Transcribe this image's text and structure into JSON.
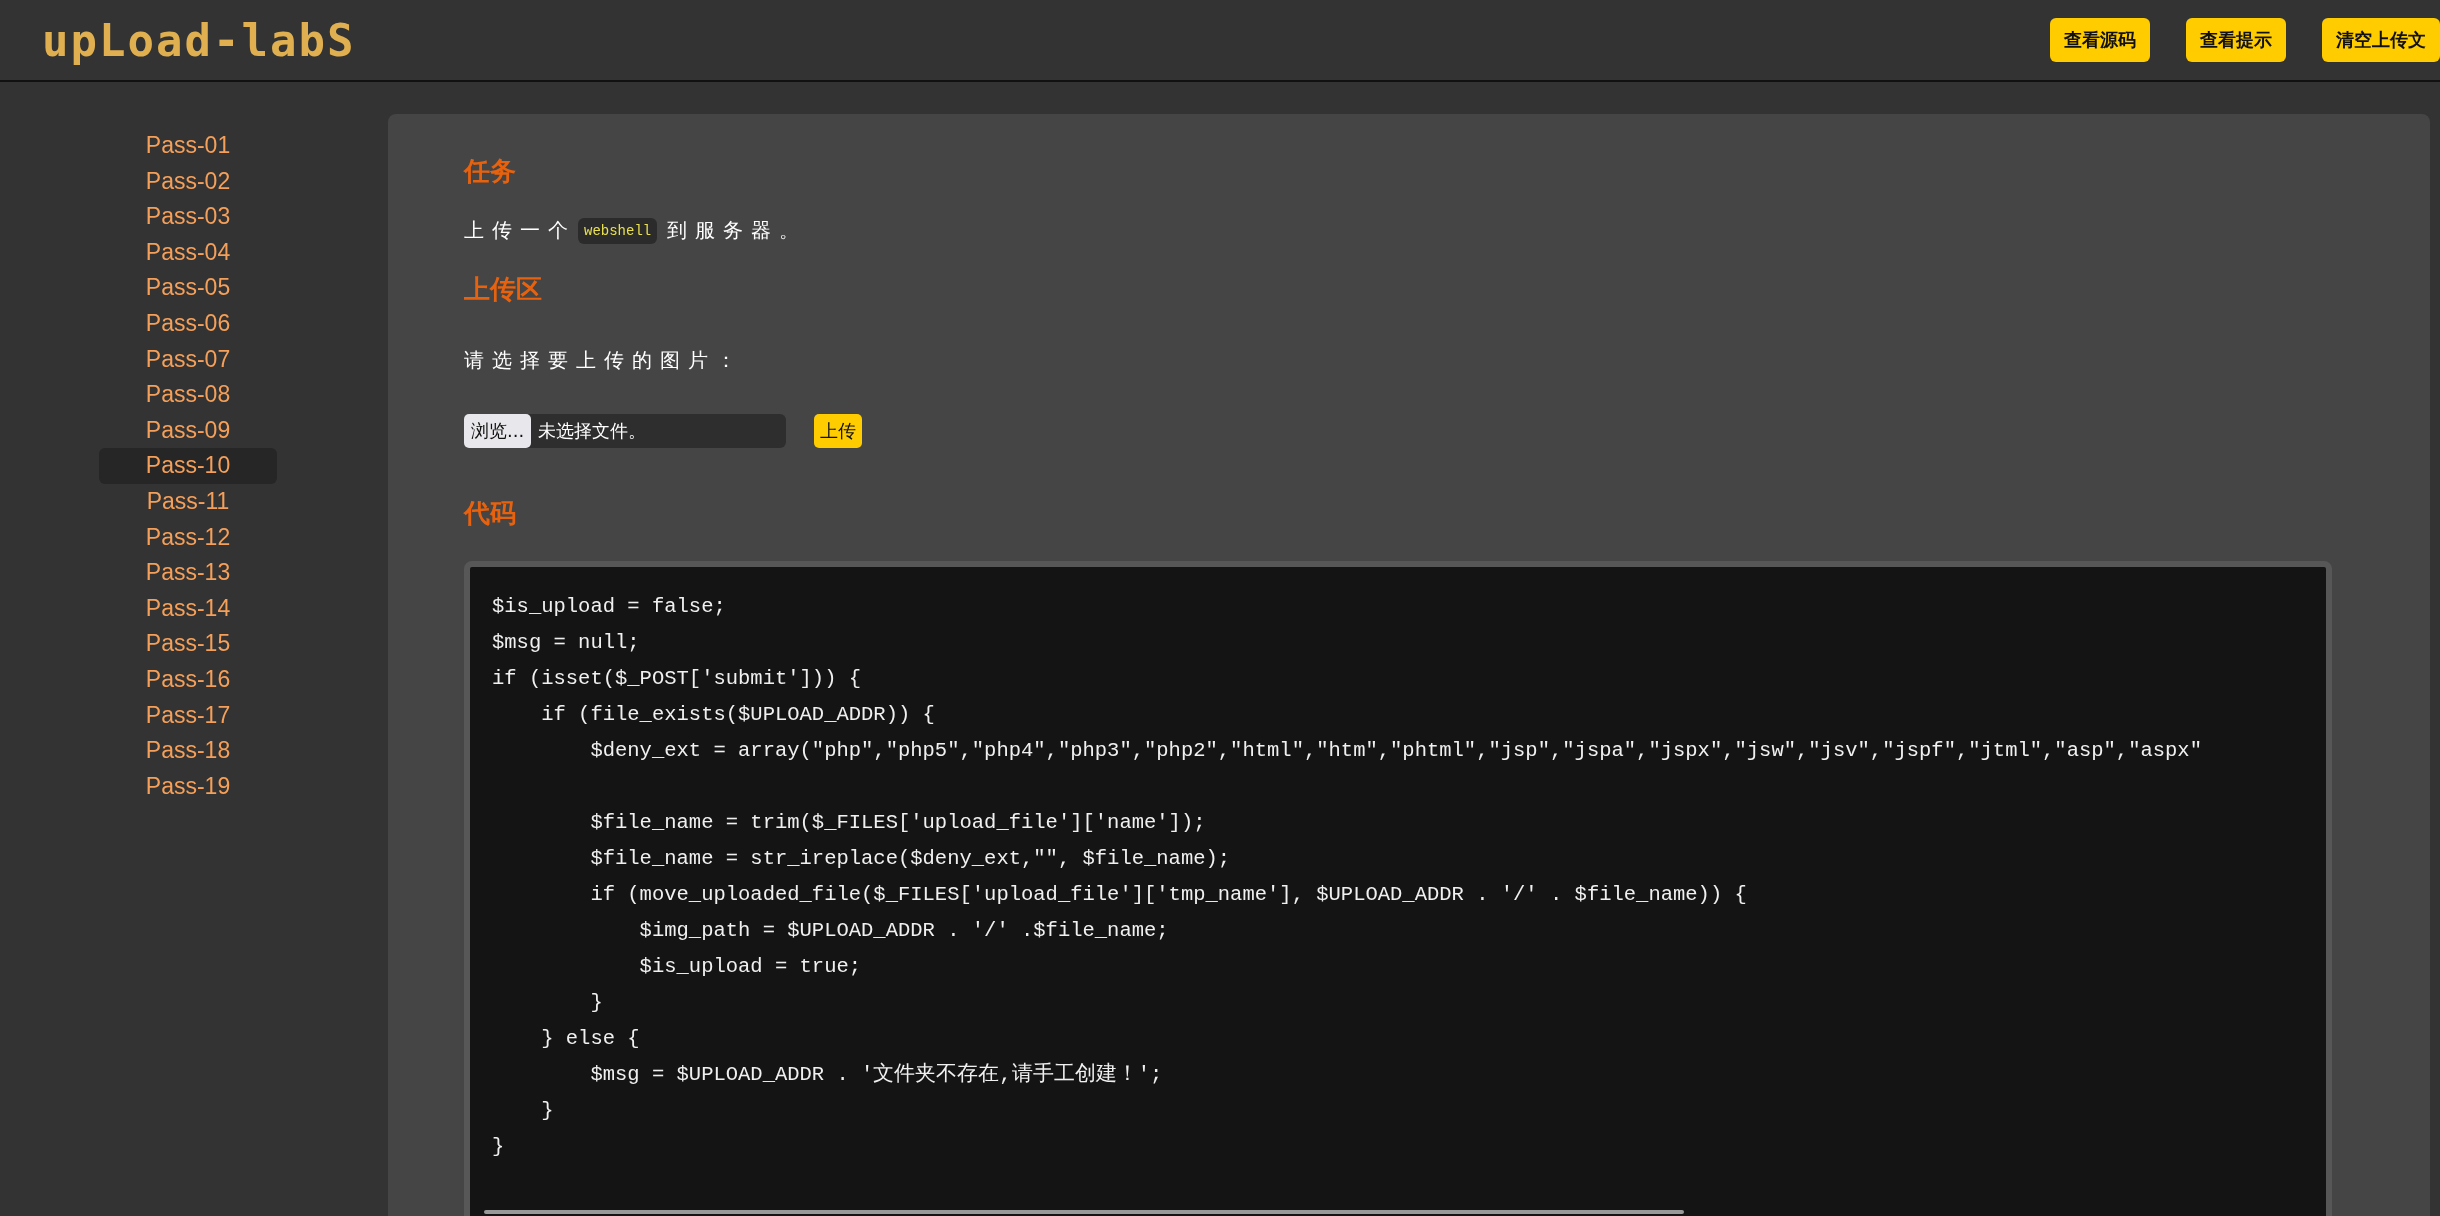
{
  "header": {
    "logo": "upLoad-labS",
    "buttons": [
      "查看源码",
      "查看提示",
      "清空上传文"
    ]
  },
  "sidebar": {
    "items": [
      {
        "label": "Pass-01",
        "selected": false
      },
      {
        "label": "Pass-02",
        "selected": false
      },
      {
        "label": "Pass-03",
        "selected": false
      },
      {
        "label": "Pass-04",
        "selected": false
      },
      {
        "label": "Pass-05",
        "selected": false
      },
      {
        "label": "Pass-06",
        "selected": false
      },
      {
        "label": "Pass-07",
        "selected": false
      },
      {
        "label": "Pass-08",
        "selected": false
      },
      {
        "label": "Pass-09",
        "selected": false
      },
      {
        "label": "Pass-10",
        "selected": true
      },
      {
        "label": "Pass-11",
        "selected": false
      },
      {
        "label": "Pass-12",
        "selected": false
      },
      {
        "label": "Pass-13",
        "selected": false
      },
      {
        "label": "Pass-14",
        "selected": false
      },
      {
        "label": "Pass-15",
        "selected": false
      },
      {
        "label": "Pass-16",
        "selected": false
      },
      {
        "label": "Pass-17",
        "selected": false
      },
      {
        "label": "Pass-18",
        "selected": false
      },
      {
        "label": "Pass-19",
        "selected": false
      }
    ]
  },
  "task": {
    "heading": "任务",
    "text_before": "上传一个",
    "code": "webshell",
    "text_after": "到服务器。"
  },
  "upload": {
    "heading": "上传区",
    "prompt": "请选择要上传的图片：",
    "browse_button": "浏览...",
    "file_status": "未选择文件。",
    "submit_button": "上传"
  },
  "code_section": {
    "heading": "代码",
    "lines": [
      "$is_upload = false;",
      "$msg = null;",
      "if (isset($_POST['submit'])) {",
      "    if (file_exists($UPLOAD_ADDR)) {",
      "        $deny_ext = array(\"php\",\"php5\",\"php4\",\"php3\",\"php2\",\"html\",\"htm\",\"phtml\",\"jsp\",\"jspa\",\"jspx\",\"jsw\",\"jsv\",\"jspf\",\"jtml\",\"asp\",\"aspx\"",
      {
        "kind": "blank"
      },
      "        $file_name = trim($_FILES['upload_file']['name']);",
      "        $file_name = str_ireplace($deny_ext,\"\", $file_name);",
      "        if (move_uploaded_file($_FILES['upload_file']['tmp_name'], $UPLOAD_ADDR . '/' . $file_name)) {",
      "            $img_path = $UPLOAD_ADDR . '/' .$file_name;",
      "            $is_upload = true;",
      "        }",
      "    } else {",
      "        $msg = $UPLOAD_ADDR . '文件夹不存在,请手工创建！';",
      "    }",
      "}"
    ]
  }
}
